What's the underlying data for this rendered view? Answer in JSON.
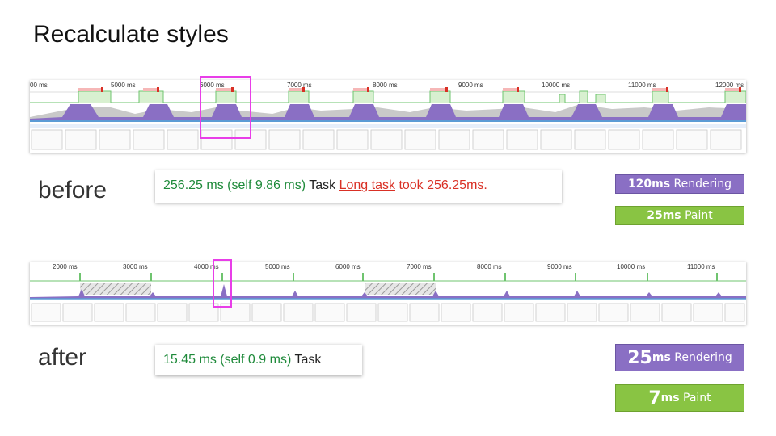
{
  "title": "Recalculate styles",
  "before": {
    "label": "before",
    "ticks": [
      "00 ms",
      "5000 ms",
      "6000 ms",
      "7000 ms",
      "8000 ms",
      "9000 ms",
      "10000 ms",
      "11000 ms",
      "12000 ms"
    ],
    "info": {
      "duration": "256.25 ms (self 9.86 ms)",
      "task": "Task",
      "link": "Long task",
      "message": "took 256.25ms."
    },
    "rendering": {
      "value": "120ms",
      "label": "Rendering"
    },
    "paint": {
      "value": "25ms",
      "label": "Paint"
    }
  },
  "after": {
    "label": "after",
    "ticks": [
      "2000 ms",
      "3000 ms",
      "4000 ms",
      "5000 ms",
      "6000 ms",
      "7000 ms",
      "8000 ms",
      "9000 ms",
      "10000 ms",
      "11000 ms"
    ],
    "info": {
      "duration": "15.45 ms (self 0.9 ms)",
      "task": "Task"
    },
    "rendering": {
      "value": "25",
      "unit": "ms",
      "label": "Rendering"
    },
    "paint": {
      "value": "7",
      "unit": "ms",
      "label": "Paint"
    }
  },
  "colors": {
    "cpu_purple": "#8a6fc4",
    "task_green": "#6fc46f",
    "highlight": "#e83ee8",
    "warn_red": "#d93025",
    "duration_green": "#1e8a3a"
  }
}
